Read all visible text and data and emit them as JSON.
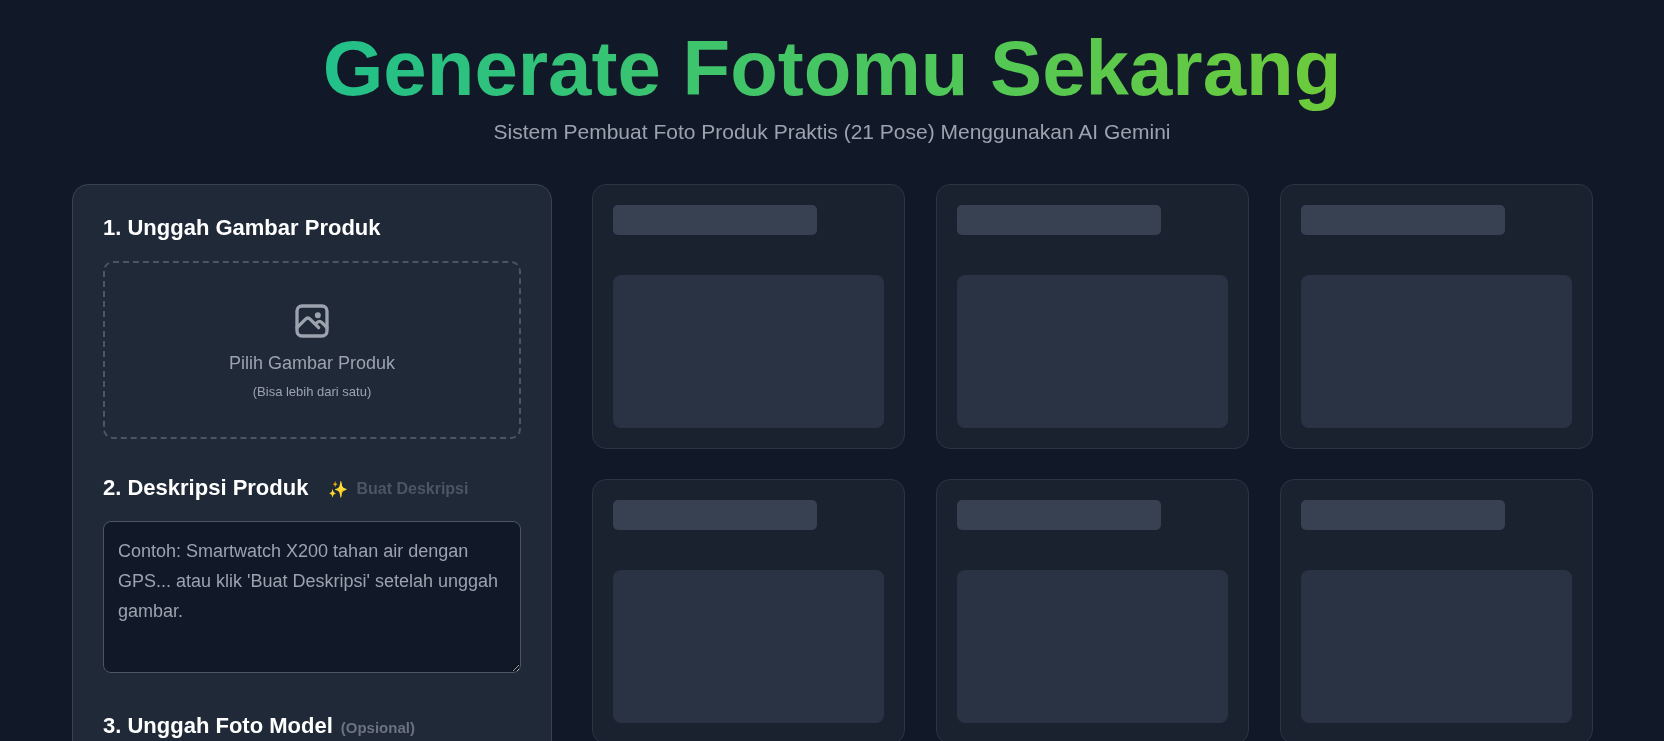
{
  "header": {
    "title": "Generate Fotomu Sekarang",
    "subtitle": "Sistem Pembuat Foto Produk Praktis (21 Pose) Menggunakan AI Gemini"
  },
  "form": {
    "sections": [
      {
        "kind": "upload",
        "heading": "1. Unggah Gambar Produk",
        "label": "Pilih Gambar Produk",
        "hint": "(Bisa lebih dari satu)"
      },
      {
        "kind": "description",
        "heading": "2. Deskripsi Produk",
        "action": {
          "icon": "✨",
          "label": "Buat Deskripsi",
          "disabled": true
        },
        "placeholder": "Contoh: Smartwatch X200 tahan air dengan GPS... atau klik 'Buat Deskripsi' setelah unggah gambar."
      },
      {
        "kind": "heading",
        "heading": "3. Unggah Foto Model",
        "note": "(Opsional)"
      }
    ]
  },
  "results": [
    {
      "kind": "placeholder"
    },
    {
      "kind": "placeholder"
    },
    {
      "kind": "placeholder"
    },
    {
      "kind": "placeholder"
    },
    {
      "kind": "placeholder"
    },
    {
      "kind": "placeholder"
    }
  ]
}
